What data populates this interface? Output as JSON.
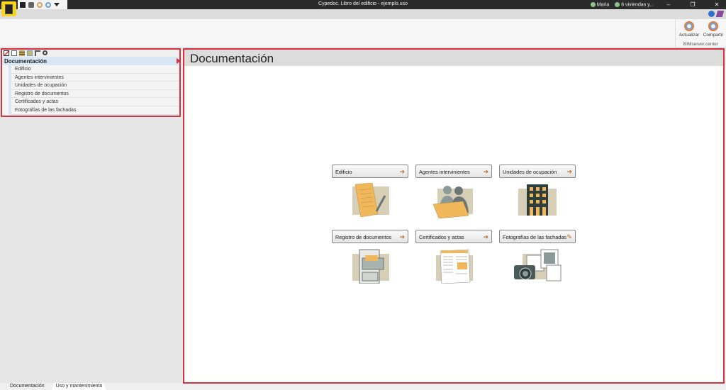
{
  "window": {
    "title": "Cypedoc. Libro del edificio - ejemplo.uso",
    "user": "Maria",
    "project": "6 viviendas y...",
    "minimize": "–",
    "restore": "❐",
    "close": "✕"
  },
  "ribbon": {
    "group_label": "BIMserver.center",
    "buttons": [
      {
        "label": "Actualizar"
      },
      {
        "label": "Compartir"
      }
    ]
  },
  "sidebar": {
    "header": "Documentación",
    "items": [
      {
        "label": "Edificio"
      },
      {
        "label": "Agentes intervinientes"
      },
      {
        "label": "Unidades de ocupación"
      },
      {
        "label": "Registro de documentos"
      },
      {
        "label": "Certificados y actas"
      },
      {
        "label": "Fotografías de las fachadas"
      }
    ]
  },
  "main": {
    "title": "Documentación",
    "cards": [
      {
        "label": "Edificio",
        "icon": "arrow-right"
      },
      {
        "label": "Agentes intervinientes",
        "icon": "arrow-right"
      },
      {
        "label": "Unidades de ocupación",
        "icon": "arrow-right"
      },
      {
        "label": "Registro de documentos",
        "icon": "arrow-right"
      },
      {
        "label": "Certificados y actas",
        "icon": "arrow-right"
      },
      {
        "label": "Fotografías de las fachadas",
        "icon": "pencil"
      }
    ]
  },
  "footer": {
    "tabs": [
      {
        "label": "Documentación"
      },
      {
        "label": "Uso y mantenimiento"
      }
    ]
  },
  "colors": {
    "accent": "#d8303e",
    "illustration": "#f0b85a"
  }
}
